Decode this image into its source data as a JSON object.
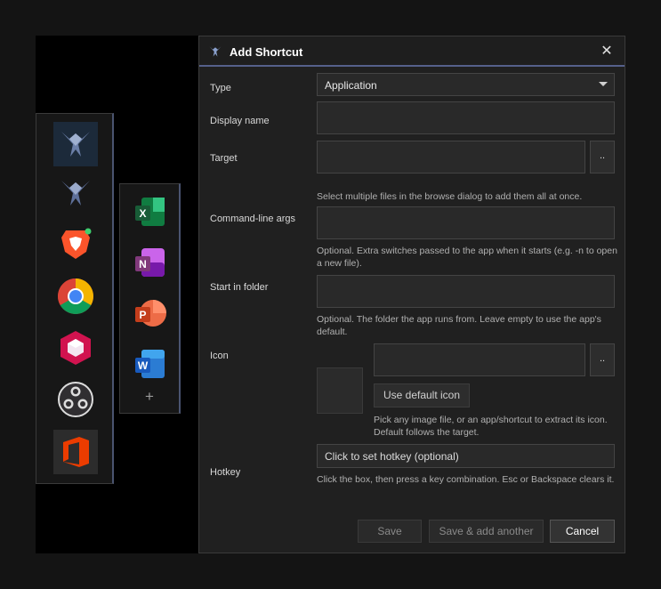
{
  "dialog": {
    "title": "Add Shortcut",
    "close_glyph": "✕",
    "type_label": "Type",
    "type_value": "Application",
    "display_name_label": "Display name",
    "display_name_value": "",
    "target_label": "Target",
    "target_value": "",
    "target_hint": "Select multiple files in the browse dialog to add them all at once.",
    "browse_label": "..",
    "args_label": "Command-line args",
    "args_value": "",
    "args_hint": "Optional. Extra switches passed to the app when it starts (e.g. -n to open a new file).",
    "folder_label": "Start in folder",
    "folder_value": "",
    "folder_hint": "Optional. The folder the app runs from. Leave empty to use the app's default.",
    "icon_label": "Icon",
    "icon_value": "",
    "use_default_icon_label": "Use default icon",
    "icon_hint": "Pick any image file, or an app/shortcut to extract its icon. Default follows the target.",
    "hotkey_label": "Hotkey",
    "hotkey_value": "Click to set hotkey (optional)",
    "hotkey_hint": "Click the box, then press a key combination. Esc or Backspace clears it.",
    "save_label": "Save",
    "save_add_label": "Save & add another",
    "cancel_label": "Cancel"
  },
  "dock_left": {
    "items": [
      {
        "icon": "launcher-logo-icon"
      },
      {
        "icon": "launcher-logo-icon"
      },
      {
        "icon": "brave-browser-icon"
      },
      {
        "icon": "chrome-icon"
      },
      {
        "icon": "hexagon-app-icon"
      },
      {
        "icon": "obs-studio-icon"
      },
      {
        "icon": "office-icon"
      }
    ]
  },
  "dock_right": {
    "items": [
      {
        "icon": "excel-icon",
        "letter": "X"
      },
      {
        "icon": "onenote-icon",
        "letter": "N"
      },
      {
        "icon": "powerpoint-icon",
        "letter": "P"
      },
      {
        "icon": "word-icon",
        "letter": "W"
      }
    ],
    "add_glyph": "+"
  },
  "colors": {
    "accent": "#55608a",
    "dialog_bg": "#202020",
    "field_bg": "#292929"
  }
}
